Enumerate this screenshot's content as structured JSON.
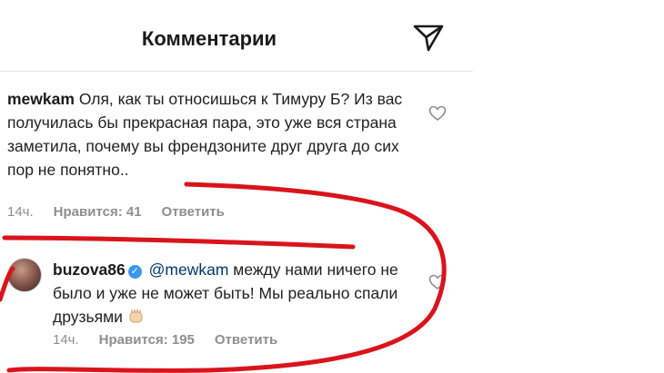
{
  "header": {
    "title": "Комментарии",
    "icon": "send-icon"
  },
  "comments": [
    {
      "username": "mewkam",
      "text": "Оля, как ты относишься к Тимуру Б?  Из вас получилась бы прекрасная пара, это уже вся страна заметила, почему вы френдзоните друг друга до сих пор не понятно..",
      "time": "14ч.",
      "likes": "Нравится: 41",
      "reply": "Ответить"
    },
    {
      "username": "buzova86",
      "verified": true,
      "mention": "@mewkam",
      "text": "между нами ничего не было и уже не может быть! Мы реально спали друзьями",
      "emoji": "fist-emoji",
      "time": "14ч.",
      "likes": "Нравится: 195",
      "reply": "Ответить"
    }
  ],
  "colors": {
    "annotation": "#d9141c",
    "meta": "#8e8e8e",
    "verified": "#3897f0"
  }
}
